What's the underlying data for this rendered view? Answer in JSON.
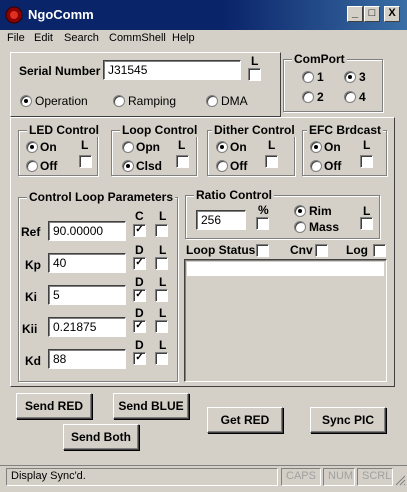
{
  "window": {
    "title": "NgoComm",
    "minimize_label": "_",
    "maximize_label": "□",
    "close_label": "X"
  },
  "menu": [
    "File",
    "Edit",
    "Search",
    "CommShell",
    "Help"
  ],
  "serial": {
    "label": "Serial Number",
    "value": "J31545",
    "l_label": "L",
    "l_checked": false
  },
  "mode": {
    "options": [
      "Operation",
      "Ramping",
      "DMA"
    ],
    "selected": "Operation"
  },
  "comport": {
    "title": "ComPort",
    "options": [
      "1",
      "3",
      "2",
      "4"
    ],
    "selected": "3"
  },
  "led_control": {
    "title": "LED Control",
    "options": [
      "On",
      "Off"
    ],
    "selected": "On",
    "l_label": "L"
  },
  "loop_control": {
    "title": "Loop Control",
    "options": [
      "Opn",
      "Clsd"
    ],
    "selected": "Clsd",
    "l_label": "L"
  },
  "dither_control": {
    "title": "Dither Control",
    "options": [
      "On",
      "Off"
    ],
    "selected": "On",
    "l_label": "L"
  },
  "efc_brdcast": {
    "title": "EFC Brdcast",
    "options": [
      "On",
      "Off"
    ],
    "selected": "On",
    "l_label": "L"
  },
  "control_loop": {
    "title": "Control Loop Parameters",
    "c_header": "C",
    "d_header": "D",
    "l_header": "L",
    "params": [
      {
        "name": "Ref",
        "value": "90.00000",
        "flag": "C",
        "checked": true
      },
      {
        "name": "Kp",
        "value": "40",
        "flag": "D",
        "checked": true
      },
      {
        "name": "Ki",
        "value": "5",
        "flag": "D",
        "checked": true
      },
      {
        "name": "Kii",
        "value": "0.21875",
        "flag": "D",
        "checked": true
      },
      {
        "name": "Kd",
        "value": "88",
        "flag": "D",
        "checked": true
      }
    ]
  },
  "ratio_control": {
    "title": "Ratio Control",
    "value": "256",
    "percent_label": "%",
    "options": [
      "Rim",
      "Mass"
    ],
    "selected": "Rim",
    "l_label": "L"
  },
  "loop_status": {
    "label": "Loop Status",
    "cnv_label": "Cnv",
    "log_label": "Log"
  },
  "buttons": {
    "send_red": "Send RED",
    "send_blue": "Send BLUE",
    "send_both": "Send Both",
    "get_red": "Get RED",
    "sync_pic": "Sync PIC"
  },
  "status": {
    "message": "Display Sync'd.",
    "caps": "CAPS",
    "num": "NUM",
    "scrl": "SCRL"
  },
  "colors": {
    "titlebar": "#0a246a",
    "face": "#d4d0c8"
  }
}
